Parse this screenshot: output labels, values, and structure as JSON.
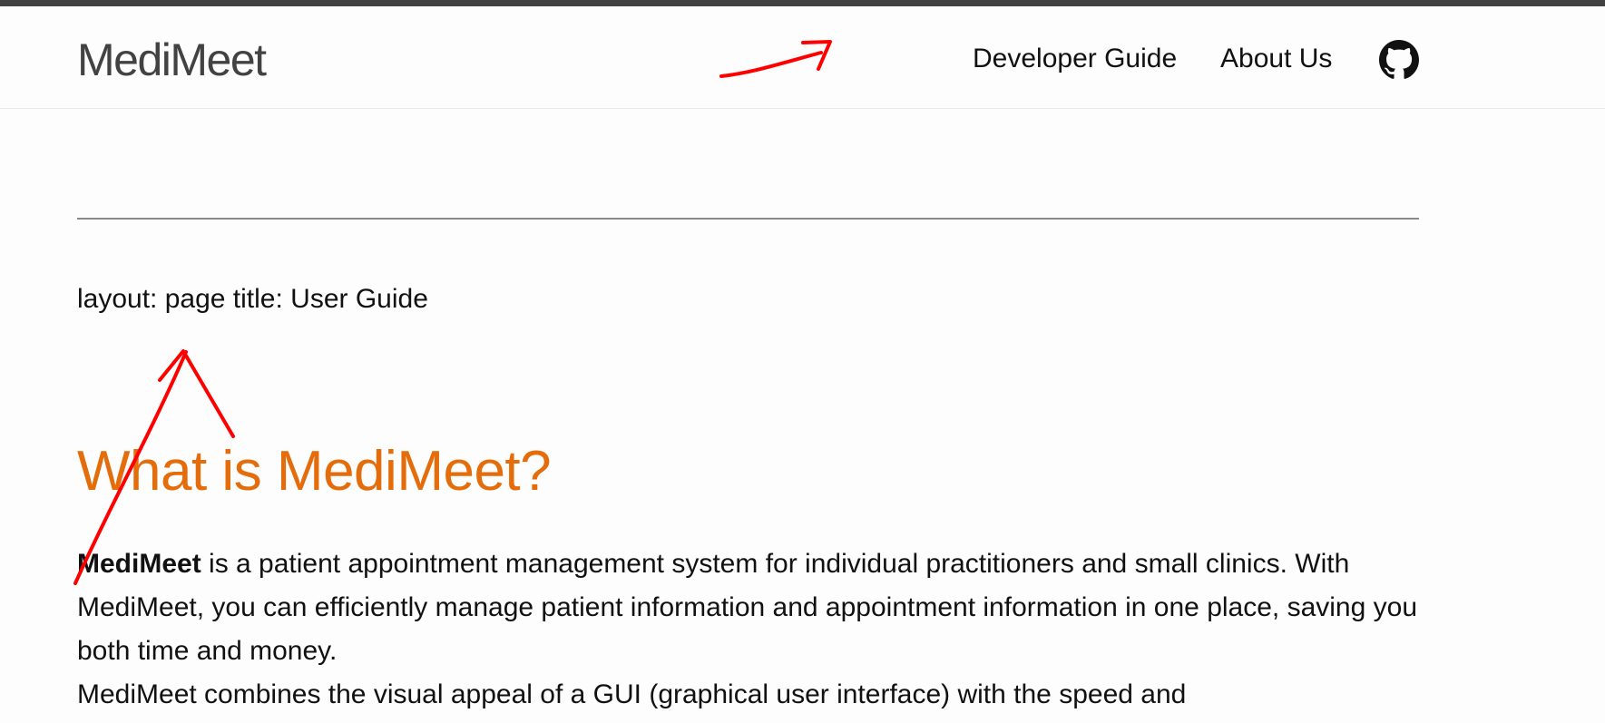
{
  "header": {
    "site_title": "MediMeet",
    "nav": [
      {
        "label": "Developer Guide"
      },
      {
        "label": "About Us"
      }
    ],
    "github_icon": "github-icon"
  },
  "main": {
    "front_matter": "layout: page title: User Guide",
    "heading": "What is MediMeet?",
    "intro_bold": "MediMeet",
    "intro_rest": " is a patient appointment management system for individual practitioners and small clinics. With MediMeet, you can efficiently manage patient information and appointment information in one place, saving you both time and money.",
    "second_paragraph": "MediMeet combines the visual appeal of a GUI (graphical user interface) with the speed and"
  },
  "colors": {
    "top_strip": "#424242",
    "site_title": "#424242",
    "heading": "#e46c0a",
    "annotation": "#ff0000"
  }
}
